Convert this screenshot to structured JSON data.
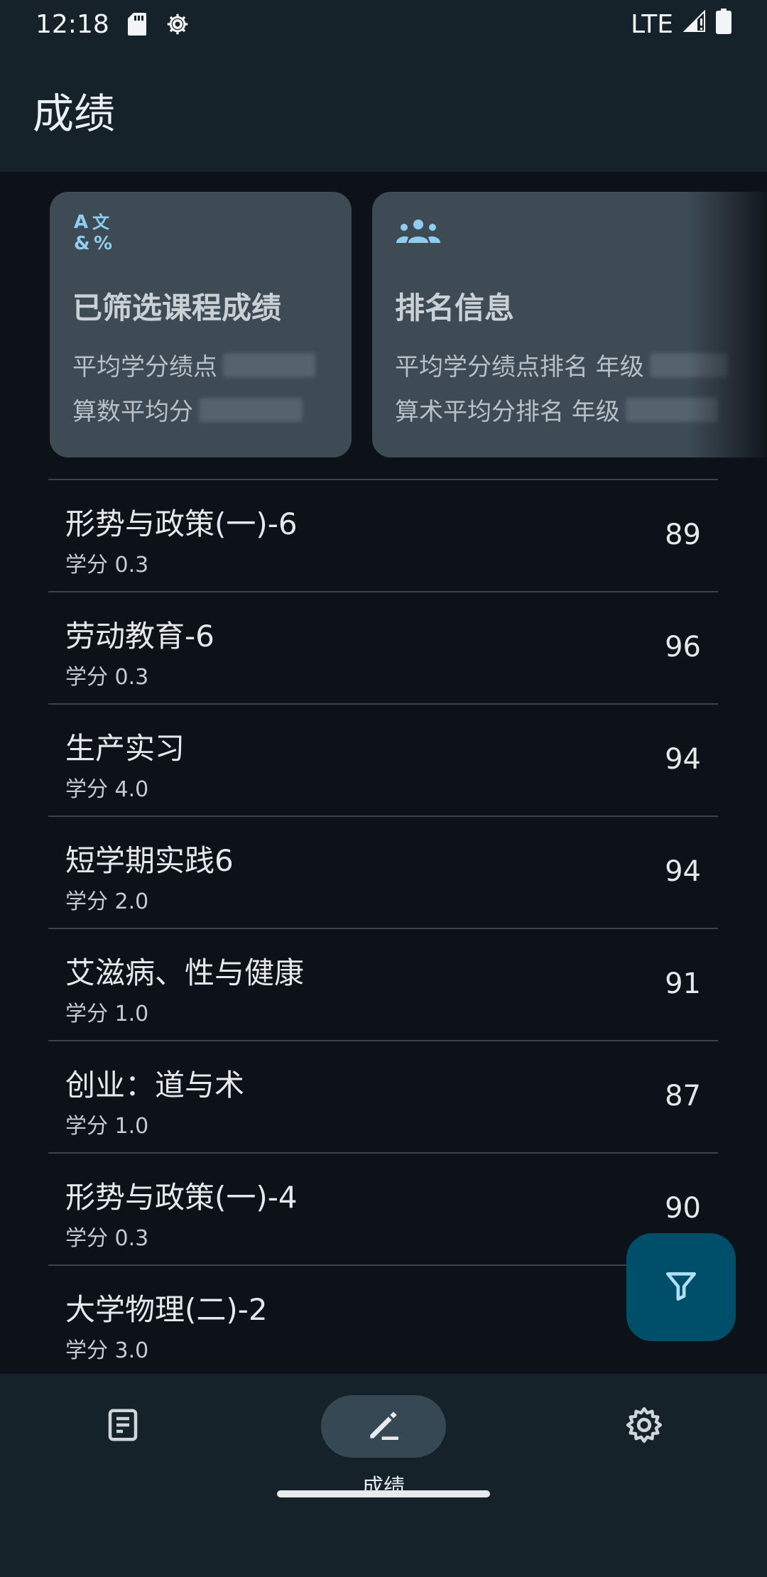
{
  "status_bar": {
    "time": "12:18",
    "network": "LTE",
    "icons": [
      "sd-card-icon",
      "settings-gear-icon",
      "signal-icon",
      "battery-icon"
    ]
  },
  "app_bar": {
    "title": "成绩"
  },
  "cards": {
    "filtered": {
      "icon": "translate-icon",
      "title": "已筛选课程成绩",
      "gpa_label": "平均学分绩点",
      "avg_label": "算数平均分"
    },
    "ranking": {
      "icon": "group-icon",
      "title": "排名信息",
      "gpa_rank_label": "平均学分绩点排名 年级",
      "avg_rank_label": "算术平均分排名 年级"
    }
  },
  "courses": [
    {
      "name": "形势与政策(一)-6",
      "credit": "学分 0.3",
      "score": "89"
    },
    {
      "name": "劳动教育-6",
      "credit": "学分 0.3",
      "score": "96"
    },
    {
      "name": "生产实习",
      "credit": "学分 4.0",
      "score": "94"
    },
    {
      "name": "短学期实践6",
      "credit": "学分 2.0",
      "score": "94"
    },
    {
      "name": "艾滋病、性与健康",
      "credit": "学分 1.0",
      "score": "91"
    },
    {
      "name": "创业：道与术",
      "credit": "学分 1.0",
      "score": "87"
    },
    {
      "name": "形势与政策(一)-4",
      "credit": "学分 0.3",
      "score": "90"
    },
    {
      "name": "大学物理(二)-2",
      "credit": "学分 3.0",
      "score": ""
    }
  ],
  "fab": {
    "icon": "filter-icon"
  },
  "bottom_nav": {
    "items": [
      {
        "icon": "list-icon",
        "label": ""
      },
      {
        "icon": "edit-icon",
        "label": "成绩",
        "active": true
      },
      {
        "icon": "settings-icon",
        "label": ""
      }
    ]
  },
  "colors": {
    "background": "#0c1218",
    "bar": "#16222a",
    "card": "#3e4a54",
    "accent": "#8fcdf0",
    "fab": "#004f6a"
  }
}
